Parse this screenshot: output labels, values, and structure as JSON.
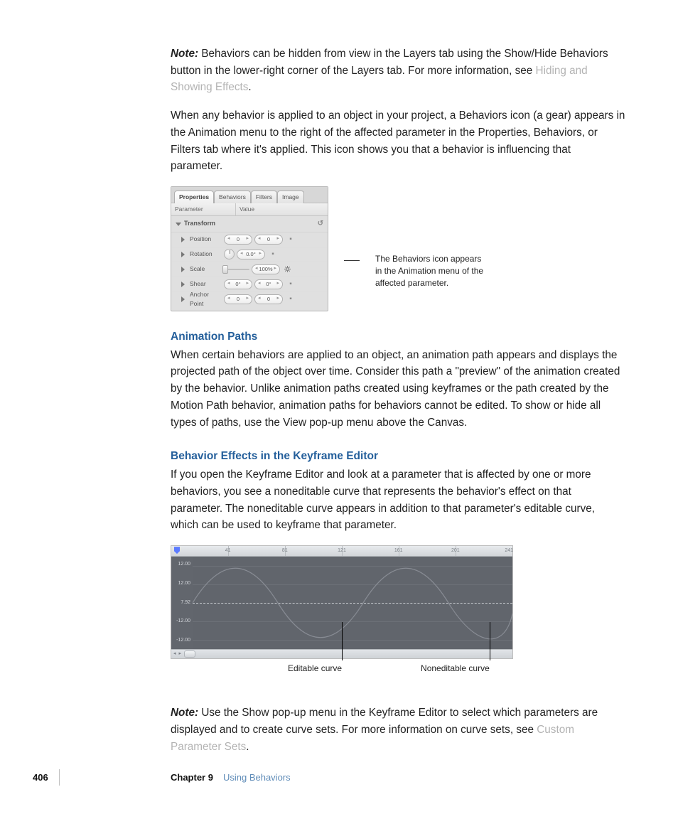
{
  "paragraphs": {
    "note1_label": "Note:",
    "note1_a": "  Behaviors can be hidden from view in the Layers tab using the Show/Hide Behaviors button in the lower-right corner of the Layers tab. For more information, see ",
    "note1_link": "Hiding and Showing Effects",
    "note1_c": ".",
    "p2": "When any behavior is applied to an object in your project, a Behaviors icon (a gear) appears in the Animation menu to the right of the affected parameter in the Properties, Behaviors, or Filters tab where it's applied. This icon shows you that a behavior is influencing that parameter.",
    "h_anim_paths": "Animation Paths",
    "p_anim_paths": "When certain behaviors are applied to an object, an animation path appears and displays the projected path of the object over time. Consider this path a \"preview\" of the animation created by the behavior. Unlike animation paths created using keyframes or the path created by the Motion Path behavior, animation paths for behaviors cannot be edited. To show or hide all types of paths, use the View pop-up menu above the Canvas.",
    "h_behavior_kf": "Behavior Effects in the Keyframe Editor",
    "p_behavior_kf": "If you open the Keyframe Editor and look at a parameter that is affected by one or more behaviors, you see a noneditable curve that represents the behavior's effect on that parameter. The noneditable curve appears in addition to that parameter's editable curve, which can be used to keyframe that parameter.",
    "note2_label": "Note:",
    "note2_a": "  Use the Show pop-up menu in the Keyframe Editor to select which parameters are displayed and to create curve sets. For more information on curve sets, see ",
    "note2_link": "Custom Parameter Sets",
    "note2_c": "."
  },
  "panel": {
    "tabs": [
      "Properties",
      "Behaviors",
      "Filters",
      "Image"
    ],
    "active_tab": 0,
    "columns": {
      "parameter": "Parameter",
      "value": "Value"
    },
    "group": "Transform",
    "rows": {
      "position": {
        "label": "Position",
        "v1": "0",
        "v2": "0"
      },
      "rotation": {
        "label": "Rotation",
        "v2": "0.0°"
      },
      "scale": {
        "label": "Scale",
        "v2": "100%"
      },
      "shear": {
        "label": "Shear",
        "v1": "0°",
        "v2": "0°"
      },
      "anchor": {
        "label": "Anchor Point",
        "v1": "0",
        "v2": "0"
      }
    },
    "callout": "The Behaviors icon appears in the Animation menu of the affected parameter."
  },
  "keyframe_editor": {
    "ticks": [
      "41",
      "81",
      "121",
      "161",
      "201",
      "241"
    ],
    "ylabels": [
      "12.00",
      "12.00",
      "7.92",
      "-12.00",
      "-12.00"
    ],
    "callouts": {
      "editable": "Editable curve",
      "noneditable": "Noneditable curve"
    }
  },
  "footer": {
    "page": "406",
    "chapter_label": "Chapter 9",
    "chapter_title": "Using Behaviors"
  }
}
